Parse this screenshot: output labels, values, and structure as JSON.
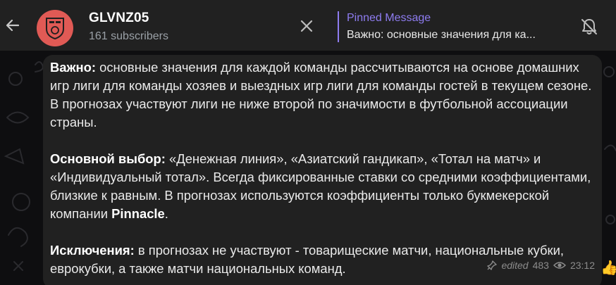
{
  "header": {
    "title": "GLVNZ05",
    "subtitle": "161 subscribers",
    "pinned_label": "Pinned Message",
    "pinned_text": "Важно: основные значения для ка..."
  },
  "message": {
    "p1_bold": "Важно:",
    "p1_text": " основные значения для каждой команды рассчитываются на основе домашних игр лиги для команды хозяев и выездных игр лиги для команды гостей в текущем сезоне. В прогнозах участвуют лиги не ниже второй по значимости в футбольной ассоциации страны.",
    "p2_bold": "Основной выбор:",
    "p2_text": " «Денежная линия», «Азиатский гандикап», «Тотал на матч» и «Индивидуальный тотал». Всегда фиксированные ставки со средними коэффициентами, близкие к равным. В прогнозах используются коэффициенты только букмекерской компании ",
    "p2_bold2": "Pinnacle",
    "p2_end": ".",
    "p3_bold": "Исключения:",
    "p3_text": " в прогнозах не участвуют - товарищеские матчи, национальные кубки, еврокубки, а также матчи национальных команд.",
    "edited": "edited",
    "views": "483",
    "time": "23:12"
  },
  "reaction": {
    "emoji": "👍"
  },
  "colors": {
    "accent": "#8e7cf0",
    "bubble": "#212121",
    "header": "#212121",
    "avatar": "#e05a55"
  },
  "icons": [
    "back-arrow-icon",
    "close-icon",
    "bell-off-icon",
    "pin-icon",
    "eye-icon",
    "thumbs-up-icon"
  ]
}
